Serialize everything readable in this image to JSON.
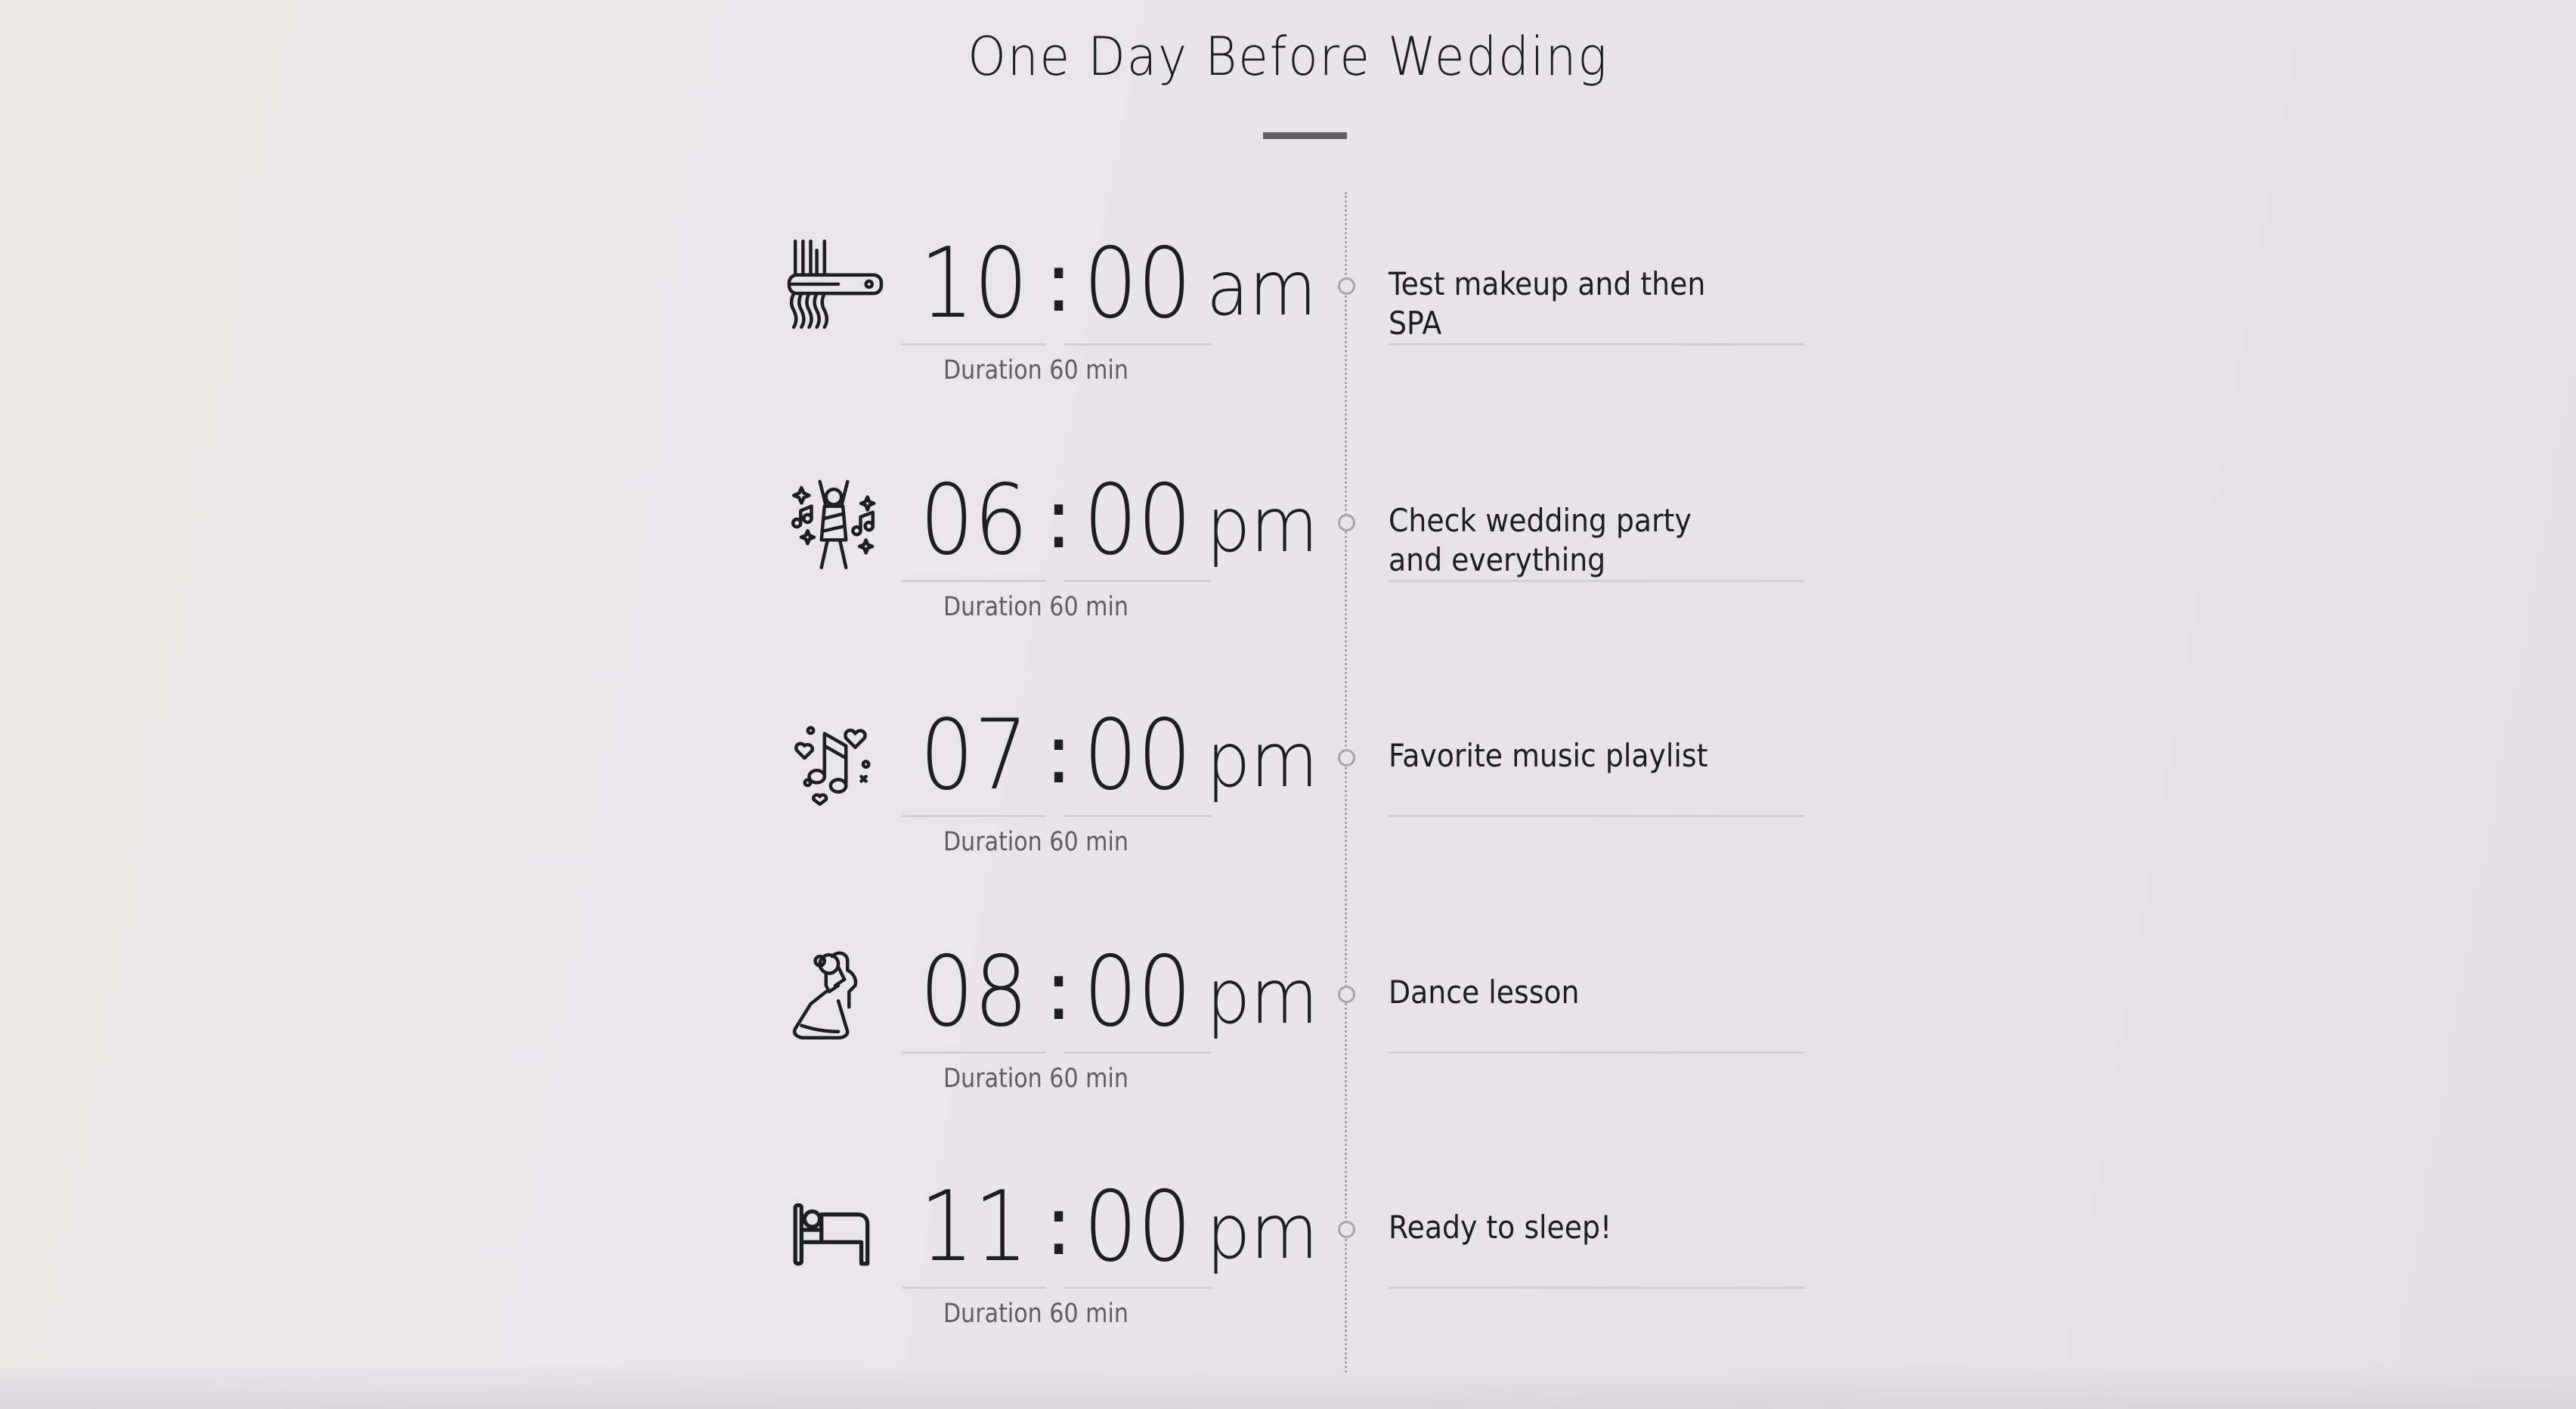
{
  "title": "One Day Before Wedding",
  "schedule": [
    {
      "icon": "hair-straightener-icon",
      "hour": "10",
      "minute": "00",
      "separator": ":",
      "meridiem": "am",
      "duration": "Duration 60 min",
      "activity": "Test makeup and then SPA"
    },
    {
      "icon": "dancing-party-icon",
      "hour": "06",
      "minute": "00",
      "separator": ":",
      "meridiem": "pm",
      "duration": "Duration 60 min",
      "activity": "Check wedding party and everything"
    },
    {
      "icon": "music-notes-hearts-icon",
      "hour": "07",
      "minute": "00",
      "separator": ":",
      "meridiem": "pm",
      "duration": "Duration 60 min",
      "activity": "Favorite music playlist"
    },
    {
      "icon": "dancing-couple-icon",
      "hour": "08",
      "minute": "00",
      "separator": ":",
      "meridiem": "pm",
      "duration": "Duration 60 min",
      "activity": "Dance lesson"
    },
    {
      "icon": "bed-icon",
      "hour": "11",
      "minute": "00",
      "separator": ":",
      "meridiem": "pm",
      "duration": "Duration 60 min",
      "activity": "Ready to sleep!"
    }
  ]
}
